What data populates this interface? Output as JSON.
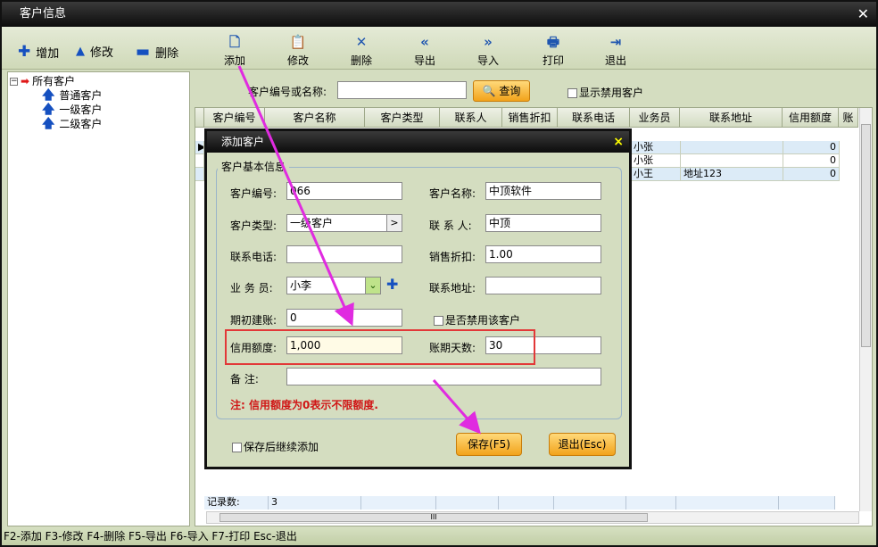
{
  "window": {
    "title": "客户信息"
  },
  "toolbar": {
    "add": "增加",
    "edit": "修改",
    "delete": "删除",
    "buttons": [
      "添加",
      "修改",
      "删除",
      "导出",
      "导入",
      "打印",
      "退出"
    ]
  },
  "tree": {
    "root": "所有客户",
    "children": [
      "普通客户",
      "一级客户",
      "二级客户"
    ]
  },
  "search": {
    "label": "客户编号或名称:",
    "value": "",
    "button": "查询",
    "show_disabled": "显示禁用客户"
  },
  "grid": {
    "columns": [
      "客户编号",
      "客户名称",
      "客户类型",
      "联系人",
      "销售折扣",
      "联系电话",
      "业务员",
      "联系地址",
      "信用额度",
      "账"
    ],
    "rows": [
      {
        "staff": "小张",
        "address": "",
        "credit": "0"
      },
      {
        "staff": "小张",
        "address": "",
        "credit": "0"
      },
      {
        "staff": "小王",
        "address": "地址123",
        "credit": "0"
      }
    ],
    "footer_label": "记录数:",
    "footer_count": "3",
    "hscroll_mark": "III"
  },
  "status": "F2-添加 F3-修改 F4-删除 F5-导出 F6-导入 F7-打印 Esc-退出",
  "dialog": {
    "title": "添加客户",
    "close": "×",
    "group_title": "客户基本信息",
    "fields": {
      "customer_no_label": "客户编号:",
      "customer_no": "066",
      "customer_name_label": "客户名称:",
      "customer_name": "中顶软件",
      "customer_type_label": "客户类型:",
      "customer_type": "一级客户",
      "contact_label": "联 系 人:",
      "contact": "中顶",
      "phone_label": "联系电话:",
      "phone": "",
      "discount_label": "销售折扣:",
      "discount": "1.00",
      "staff_label": "业 务 员:",
      "staff": "小李",
      "address_label": "联系地址:",
      "address": "",
      "opening_label": "期初建账:",
      "opening": "0",
      "disable_label": "是否禁用该客户",
      "credit_label": "信用额度:",
      "credit": "1,000",
      "days_label": "账期天数:",
      "days": "30",
      "remark_label": "备    注:",
      "remark": ""
    },
    "note": "注: 信用额度为0表示不限额度.",
    "keep_adding": "保存后继续添加",
    "save": "保存(F5)",
    "exit": "退出(Esc)"
  }
}
